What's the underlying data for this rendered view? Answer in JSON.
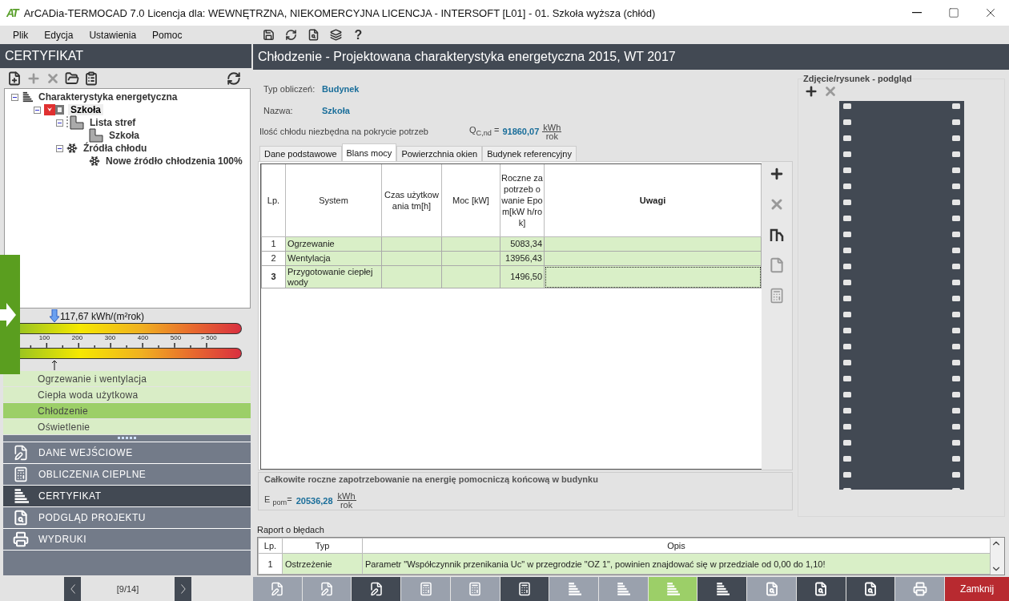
{
  "window": {
    "logo": "AT",
    "title": "ArCADia-TERMOCAD 7.0 Licencja dla: WEWNĘTRZNA, NIEKOMERCYJNA LICENCJA - INTERSOFT [L01] - 01. Szkoła wyższa (chłód)"
  },
  "menu": [
    "Plik",
    "Edycja",
    "Ustawienia",
    "Pomoc"
  ],
  "toolbar": [
    {
      "kind": "save"
    },
    {
      "kind": "refresh"
    },
    {
      "kind": "preview"
    },
    {
      "kind": "layers"
    },
    {
      "kind": "help",
      "glyph": "?"
    }
  ],
  "left_panel": {
    "title": "CERTYFIKAT",
    "tools": [
      {
        "kind": "new",
        "disabled": false
      },
      {
        "kind": "add",
        "disabled": true
      },
      {
        "kind": "delete",
        "disabled": true
      },
      {
        "kind": "folder",
        "disabled": false
      },
      {
        "kind": "list",
        "disabled": false
      }
    ],
    "tree": [
      {
        "label": "Charakterystyka energetyczna",
        "kind": "bars",
        "expanded": true,
        "selected": false,
        "children": [
          {
            "label": "Szkoła",
            "kind": "emblem",
            "expanded": true,
            "selected": true,
            "children": [
              {
                "label": "Lista stref",
                "kind": "zones",
                "expanded": true,
                "selected": false,
                "children": [
                  {
                    "label": "Szkoła",
                    "kind": "zone",
                    "selected": false
                  }
                ]
              },
              {
                "label": "Źródła chłodu",
                "kind": "snowflake",
                "expanded": true,
                "selected": false,
                "children": [
                  {
                    "label": "Nowe źródło chłodzenia 100%",
                    "kind": "snowflake",
                    "selected": false
                  }
                ]
              }
            ]
          }
        ]
      }
    ],
    "scale": {
      "reading": "117,67 kWh/(m²rok)",
      "level": 0.155,
      "ticks": [
        "100",
        "200",
        "300",
        "400",
        "500",
        "> 500"
      ]
    },
    "categories": [
      {
        "label": "Ogrzewanie i wentylacja",
        "selected": false
      },
      {
        "label": "Ciepła woda użytkowa",
        "selected": false
      },
      {
        "label": "Chłodzenie",
        "selected": true
      },
      {
        "label": "Oświetlenie",
        "selected": false
      }
    ],
    "sections": [
      {
        "label": "DANE WEJŚCIOWE",
        "kind": "edit",
        "selected": false
      },
      {
        "label": "OBLICZENIA CIEPLNE",
        "kind": "calc",
        "selected": false
      },
      {
        "label": "CERTYFIKAT",
        "kind": "bars",
        "selected": true
      },
      {
        "label": "PODGLĄD PROJEKTU",
        "kind": "preview",
        "selected": false
      },
      {
        "label": "WYDRUKI",
        "kind": "print",
        "selected": false
      }
    ],
    "pager": "[9/14]"
  },
  "header": "Chłodzenie - Projektowana charakterystyka energetyczna 2015, WT 2017",
  "info": [
    {
      "label": "Typ obliczeń:",
      "value": "Budynek"
    },
    {
      "label": "Nazwa:",
      "value": "Szkoła"
    }
  ],
  "demand": {
    "label": "Ilość chłodu niezbędna na pokrycie potrzeb",
    "symbol": "Q$_{C,nd}$ =",
    "value": "91860,07",
    "unit_top": "kWh",
    "unit_bottom": "rok"
  },
  "tabs": [
    {
      "label": "Dane podstawowe",
      "selected": false
    },
    {
      "label": "Blans mocy",
      "selected": true
    },
    {
      "label": "Powierzchnia okien",
      "selected": false
    },
    {
      "label": "Budynek referencyjny",
      "selected": false
    }
  ],
  "table": {
    "columns": [
      {
        "label": "Lp.",
        "bold": false
      },
      {
        "label": "System",
        "bold": false
      },
      {
        "label": "Czas użytkowania tm[h]",
        "bold": false
      },
      {
        "label": "Moc [kW]",
        "bold": false
      },
      {
        "label": "Roczne zapotrzeb owanie Epom[kW h/rok]",
        "bold": false
      },
      {
        "label": "Uwagi",
        "bold": true
      }
    ],
    "rows": [
      {
        "lp": "1",
        "system": "Ogrzewanie",
        "czas": "",
        "moc": "",
        "roczne": "5083,34",
        "uwagi": "",
        "selected": false
      },
      {
        "lp": "2",
        "system": "Wentylacja",
        "czas": "",
        "moc": "",
        "roczne": "13956,43",
        "uwagi": "",
        "selected": false
      },
      {
        "lp": "3",
        "system": "Przygotowanie ciepłej wody",
        "czas": "",
        "moc": "",
        "roczne": "1496,50",
        "uwagi": "",
        "selected": true
      }
    ]
  },
  "side_tools": [
    {
      "kind": "add",
      "disabled": false
    },
    {
      "kind": "delete",
      "disabled": true
    },
    {
      "kind": "hook",
      "disabled": false
    },
    {
      "kind": "paste",
      "disabled": true
    },
    {
      "kind": "calc",
      "disabled": true
    }
  ],
  "summary": {
    "title": "Całkowite roczne zapotrzebowanie na energię pomocniczą końcową w budynku",
    "symbol": "E $_{pom}$=",
    "value": "20536,28",
    "unit_top": "kWh",
    "unit_bottom": "rok"
  },
  "picture_panel": {
    "title": "Zdjęcie/rysunek - podgląd",
    "tools": [
      {
        "kind": "add",
        "disabled": false
      },
      {
        "kind": "delete",
        "disabled": true
      }
    ]
  },
  "errors": {
    "title": "Raport o błędach",
    "columns": [
      "Lp.",
      "Typ",
      "Opis"
    ],
    "rows": [
      {
        "lp": "1",
        "type": "Ostrzeżenie",
        "description": "Parametr \"Współczynnik przenikania Uc\" w przegrodzie \"OZ 1\", powinien znajdować się w przedziale od 0,00 do 1,10!"
      }
    ]
  },
  "bottom_tools": [
    {
      "kind": "edit",
      "color": "#9aa1ad"
    },
    {
      "kind": "edit",
      "color": "#9aa1ad"
    },
    {
      "kind": "edit",
      "color": "#424953"
    },
    {
      "kind": "calc",
      "color": "#9aa1ad"
    },
    {
      "kind": "calc",
      "color": "#9aa1ad"
    },
    {
      "kind": "calc",
      "color": "#424953"
    },
    {
      "kind": "bars",
      "color": "#9aa1ad"
    },
    {
      "kind": "bars",
      "color": "#9aa1ad"
    },
    {
      "kind": "bars",
      "color": "#9ccf68"
    },
    {
      "kind": "bars",
      "color": "#424953"
    },
    {
      "kind": "preview",
      "color": "#9aa1ad"
    },
    {
      "kind": "preview",
      "color": "#424953"
    },
    {
      "kind": "preview",
      "color": "#424953"
    },
    {
      "kind": "print",
      "color": "#9aa1ad"
    }
  ],
  "close_button": "Zamknij"
}
